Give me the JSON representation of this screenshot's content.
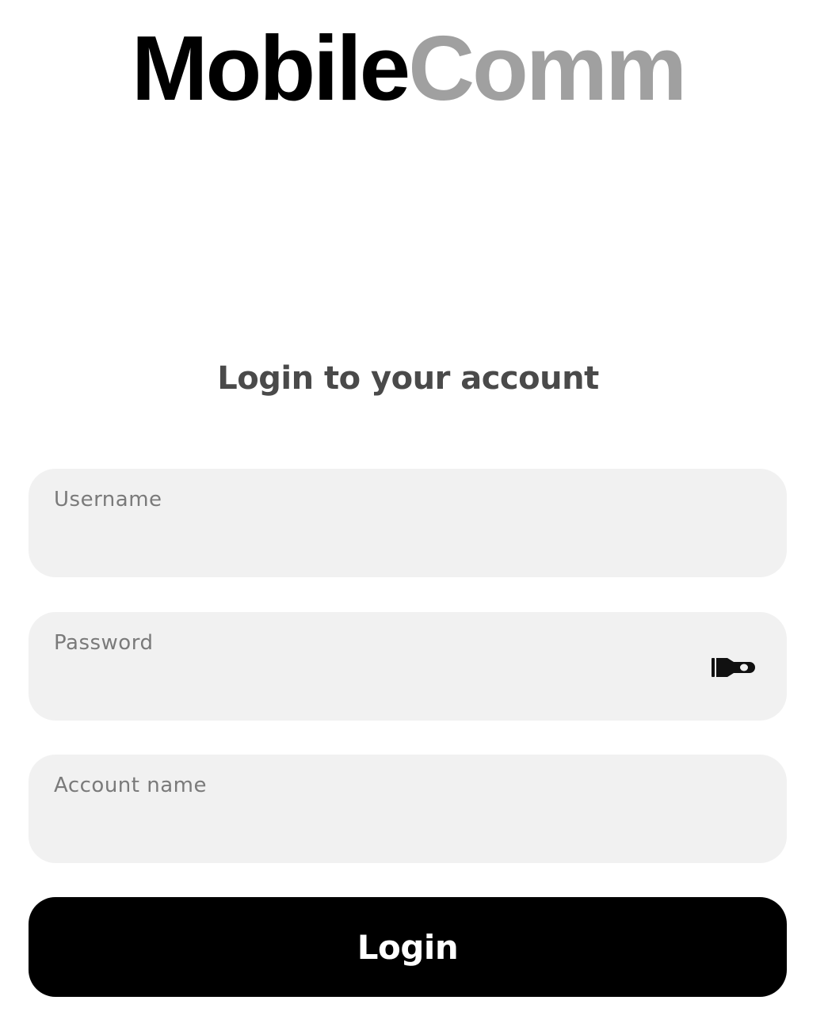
{
  "brand": {
    "name_part1": "Mobile",
    "name_part2": "Comm",
    "color_primary": "#000000",
    "color_secondary": "#a0a0a0"
  },
  "login_form": {
    "heading": "Login to your account",
    "fields": {
      "username": {
        "label": "Username",
        "value": ""
      },
      "password": {
        "label": "Password",
        "value": "",
        "toggle_icon": "flashlight-icon"
      },
      "account_name": {
        "label": "Account name",
        "value": ""
      }
    },
    "submit_label": "Login"
  }
}
